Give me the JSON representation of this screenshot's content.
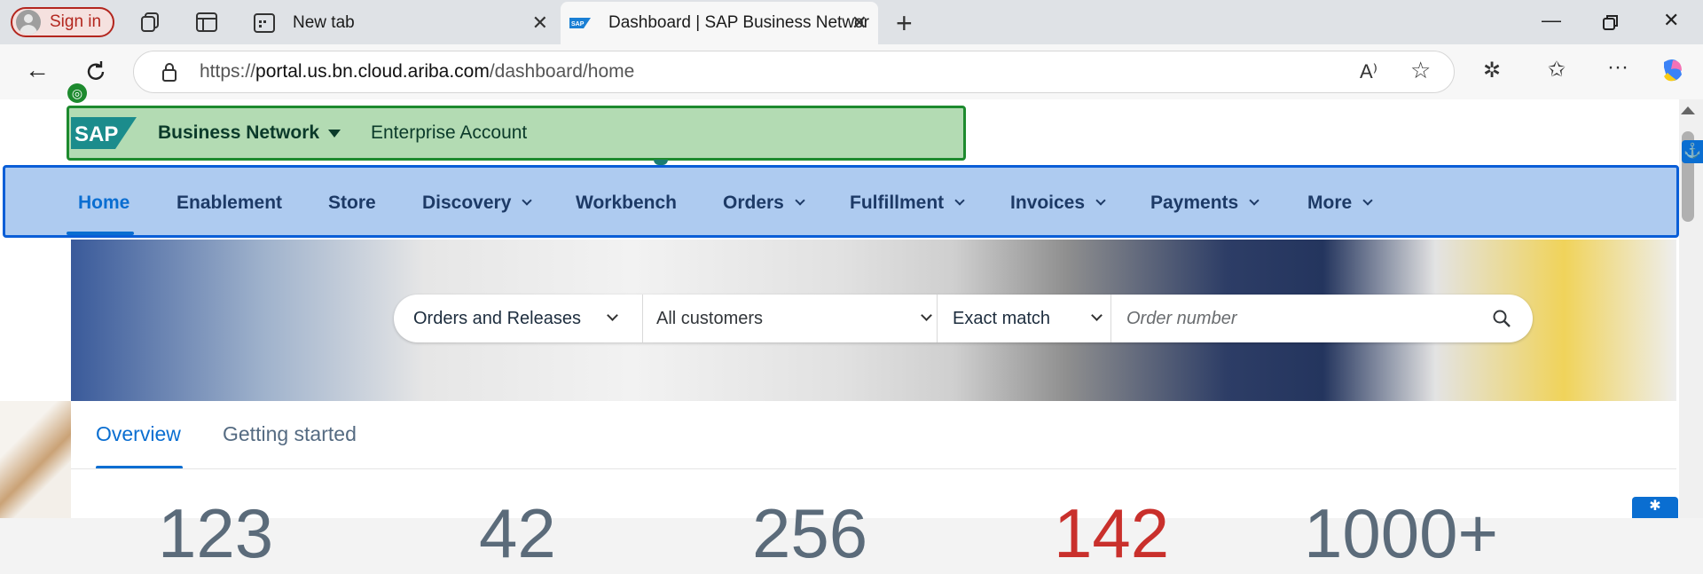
{
  "browser": {
    "signin_label": "Sign in",
    "tabs": [
      {
        "title": "New tab"
      },
      {
        "title": "Dashboard | SAP Business Networ",
        "favicon": "SAP"
      }
    ],
    "url_host": "portal.us.bn.cloud.ariba.com",
    "url_scheme": "https://",
    "url_path": "/dashboard/home"
  },
  "sap": {
    "logo_text": "SAP",
    "product": "Business Network",
    "account": "Enterprise Account"
  },
  "nav": {
    "items": [
      {
        "label": "Home",
        "has_menu": false
      },
      {
        "label": "Enablement",
        "has_menu": false
      },
      {
        "label": "Store",
        "has_menu": false
      },
      {
        "label": "Discovery",
        "has_menu": true
      },
      {
        "label": "Workbench",
        "has_menu": false
      },
      {
        "label": "Orders",
        "has_menu": true
      },
      {
        "label": "Fulfillment",
        "has_menu": true
      },
      {
        "label": "Invoices",
        "has_menu": true
      },
      {
        "label": "Payments",
        "has_menu": true
      },
      {
        "label": "More",
        "has_menu": true
      }
    ]
  },
  "search": {
    "doc_type": "Orders and Releases",
    "customer": "All customers",
    "match": "Exact match",
    "placeholder": "Order number"
  },
  "panel": {
    "tabs": [
      "Overview",
      "Getting started"
    ]
  },
  "kpis": [
    "123",
    "42",
    "256",
    "142",
    "1000+"
  ],
  "colors": {
    "sap_highlight": "#b3dbb3",
    "nav_highlight": "#aecbf0",
    "accent": "#0a6ed1",
    "alert_red": "#c9302c"
  }
}
